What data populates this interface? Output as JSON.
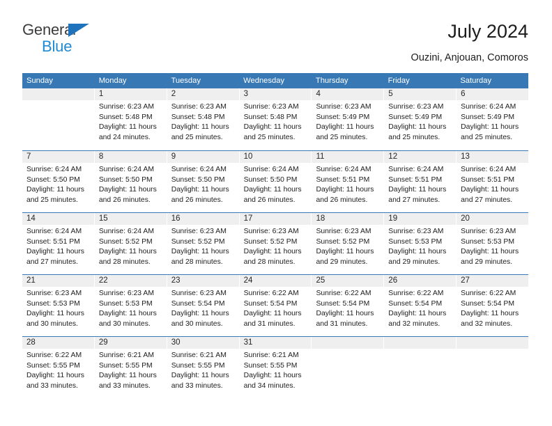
{
  "brand": {
    "name_top": "General",
    "name_bottom": "Blue",
    "accent_color": "#1f8ad6",
    "triangle_color": "#1f73bd"
  },
  "header": {
    "title": "July 2024",
    "location": "Ouzini, Anjouan, Comoros"
  },
  "calendar": {
    "header_color": "#3878b4",
    "daynum_band_color": "#efefef",
    "weekday_headers": [
      "Sunday",
      "Monday",
      "Tuesday",
      "Wednesday",
      "Thursday",
      "Friday",
      "Saturday"
    ],
    "weeks": [
      [
        {
          "date": "",
          "sunrise": "",
          "sunset": "",
          "daylight_1": "",
          "daylight_2": "",
          "empty": true
        },
        {
          "date": "1",
          "sunrise": "Sunrise: 6:23 AM",
          "sunset": "Sunset: 5:48 PM",
          "daylight_1": "Daylight: 11 hours",
          "daylight_2": "and 24 minutes."
        },
        {
          "date": "2",
          "sunrise": "Sunrise: 6:23 AM",
          "sunset": "Sunset: 5:48 PM",
          "daylight_1": "Daylight: 11 hours",
          "daylight_2": "and 25 minutes."
        },
        {
          "date": "3",
          "sunrise": "Sunrise: 6:23 AM",
          "sunset": "Sunset: 5:48 PM",
          "daylight_1": "Daylight: 11 hours",
          "daylight_2": "and 25 minutes."
        },
        {
          "date": "4",
          "sunrise": "Sunrise: 6:23 AM",
          "sunset": "Sunset: 5:49 PM",
          "daylight_1": "Daylight: 11 hours",
          "daylight_2": "and 25 minutes."
        },
        {
          "date": "5",
          "sunrise": "Sunrise: 6:23 AM",
          "sunset": "Sunset: 5:49 PM",
          "daylight_1": "Daylight: 11 hours",
          "daylight_2": "and 25 minutes."
        },
        {
          "date": "6",
          "sunrise": "Sunrise: 6:24 AM",
          "sunset": "Sunset: 5:49 PM",
          "daylight_1": "Daylight: 11 hours",
          "daylight_2": "and 25 minutes."
        }
      ],
      [
        {
          "date": "7",
          "sunrise": "Sunrise: 6:24 AM",
          "sunset": "Sunset: 5:50 PM",
          "daylight_1": "Daylight: 11 hours",
          "daylight_2": "and 25 minutes."
        },
        {
          "date": "8",
          "sunrise": "Sunrise: 6:24 AM",
          "sunset": "Sunset: 5:50 PM",
          "daylight_1": "Daylight: 11 hours",
          "daylight_2": "and 26 minutes."
        },
        {
          "date": "9",
          "sunrise": "Sunrise: 6:24 AM",
          "sunset": "Sunset: 5:50 PM",
          "daylight_1": "Daylight: 11 hours",
          "daylight_2": "and 26 minutes."
        },
        {
          "date": "10",
          "sunrise": "Sunrise: 6:24 AM",
          "sunset": "Sunset: 5:50 PM",
          "daylight_1": "Daylight: 11 hours",
          "daylight_2": "and 26 minutes."
        },
        {
          "date": "11",
          "sunrise": "Sunrise: 6:24 AM",
          "sunset": "Sunset: 5:51 PM",
          "daylight_1": "Daylight: 11 hours",
          "daylight_2": "and 26 minutes."
        },
        {
          "date": "12",
          "sunrise": "Sunrise: 6:24 AM",
          "sunset": "Sunset: 5:51 PM",
          "daylight_1": "Daylight: 11 hours",
          "daylight_2": "and 27 minutes."
        },
        {
          "date": "13",
          "sunrise": "Sunrise: 6:24 AM",
          "sunset": "Sunset: 5:51 PM",
          "daylight_1": "Daylight: 11 hours",
          "daylight_2": "and 27 minutes."
        }
      ],
      [
        {
          "date": "14",
          "sunrise": "Sunrise: 6:24 AM",
          "sunset": "Sunset: 5:51 PM",
          "daylight_1": "Daylight: 11 hours",
          "daylight_2": "and 27 minutes."
        },
        {
          "date": "15",
          "sunrise": "Sunrise: 6:24 AM",
          "sunset": "Sunset: 5:52 PM",
          "daylight_1": "Daylight: 11 hours",
          "daylight_2": "and 28 minutes."
        },
        {
          "date": "16",
          "sunrise": "Sunrise: 6:23 AM",
          "sunset": "Sunset: 5:52 PM",
          "daylight_1": "Daylight: 11 hours",
          "daylight_2": "and 28 minutes."
        },
        {
          "date": "17",
          "sunrise": "Sunrise: 6:23 AM",
          "sunset": "Sunset: 5:52 PM",
          "daylight_1": "Daylight: 11 hours",
          "daylight_2": "and 28 minutes."
        },
        {
          "date": "18",
          "sunrise": "Sunrise: 6:23 AM",
          "sunset": "Sunset: 5:52 PM",
          "daylight_1": "Daylight: 11 hours",
          "daylight_2": "and 29 minutes."
        },
        {
          "date": "19",
          "sunrise": "Sunrise: 6:23 AM",
          "sunset": "Sunset: 5:53 PM",
          "daylight_1": "Daylight: 11 hours",
          "daylight_2": "and 29 minutes."
        },
        {
          "date": "20",
          "sunrise": "Sunrise: 6:23 AM",
          "sunset": "Sunset: 5:53 PM",
          "daylight_1": "Daylight: 11 hours",
          "daylight_2": "and 29 minutes."
        }
      ],
      [
        {
          "date": "21",
          "sunrise": "Sunrise: 6:23 AM",
          "sunset": "Sunset: 5:53 PM",
          "daylight_1": "Daylight: 11 hours",
          "daylight_2": "and 30 minutes."
        },
        {
          "date": "22",
          "sunrise": "Sunrise: 6:23 AM",
          "sunset": "Sunset: 5:53 PM",
          "daylight_1": "Daylight: 11 hours",
          "daylight_2": "and 30 minutes."
        },
        {
          "date": "23",
          "sunrise": "Sunrise: 6:23 AM",
          "sunset": "Sunset: 5:54 PM",
          "daylight_1": "Daylight: 11 hours",
          "daylight_2": "and 30 minutes."
        },
        {
          "date": "24",
          "sunrise": "Sunrise: 6:22 AM",
          "sunset": "Sunset: 5:54 PM",
          "daylight_1": "Daylight: 11 hours",
          "daylight_2": "and 31 minutes."
        },
        {
          "date": "25",
          "sunrise": "Sunrise: 6:22 AM",
          "sunset": "Sunset: 5:54 PM",
          "daylight_1": "Daylight: 11 hours",
          "daylight_2": "and 31 minutes."
        },
        {
          "date": "26",
          "sunrise": "Sunrise: 6:22 AM",
          "sunset": "Sunset: 5:54 PM",
          "daylight_1": "Daylight: 11 hours",
          "daylight_2": "and 32 minutes."
        },
        {
          "date": "27",
          "sunrise": "Sunrise: 6:22 AM",
          "sunset": "Sunset: 5:54 PM",
          "daylight_1": "Daylight: 11 hours",
          "daylight_2": "and 32 minutes."
        }
      ],
      [
        {
          "date": "28",
          "sunrise": "Sunrise: 6:22 AM",
          "sunset": "Sunset: 5:55 PM",
          "daylight_1": "Daylight: 11 hours",
          "daylight_2": "and 33 minutes."
        },
        {
          "date": "29",
          "sunrise": "Sunrise: 6:21 AM",
          "sunset": "Sunset: 5:55 PM",
          "daylight_1": "Daylight: 11 hours",
          "daylight_2": "and 33 minutes."
        },
        {
          "date": "30",
          "sunrise": "Sunrise: 6:21 AM",
          "sunset": "Sunset: 5:55 PM",
          "daylight_1": "Daylight: 11 hours",
          "daylight_2": "and 33 minutes."
        },
        {
          "date": "31",
          "sunrise": "Sunrise: 6:21 AM",
          "sunset": "Sunset: 5:55 PM",
          "daylight_1": "Daylight: 11 hours",
          "daylight_2": "and 34 minutes."
        },
        {
          "date": "",
          "sunrise": "",
          "sunset": "",
          "daylight_1": "",
          "daylight_2": "",
          "empty": true
        },
        {
          "date": "",
          "sunrise": "",
          "sunset": "",
          "daylight_1": "",
          "daylight_2": "",
          "empty": true
        },
        {
          "date": "",
          "sunrise": "",
          "sunset": "",
          "daylight_1": "",
          "daylight_2": "",
          "empty": true
        }
      ]
    ]
  }
}
